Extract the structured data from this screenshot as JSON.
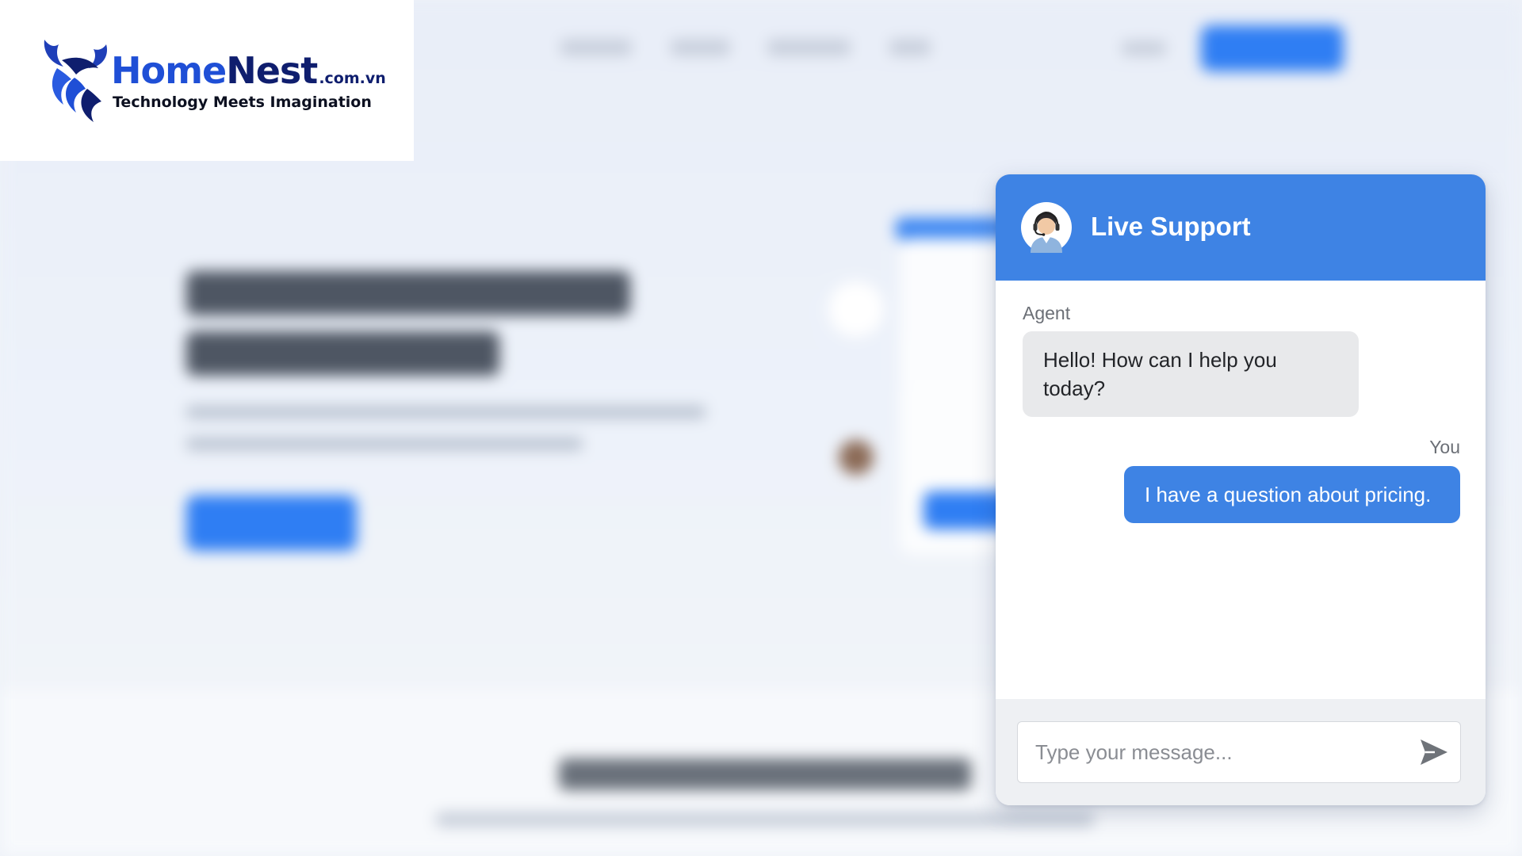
{
  "brand": {
    "name_part1": "Home",
    "name_part2": "Nest",
    "domain": ".com.vn",
    "tagline": "Technology Meets Imagination"
  },
  "chat": {
    "title": "Live Support",
    "messages": [
      {
        "sender": "Agent",
        "text": "Hello! How can I help you today?"
      },
      {
        "sender": "You",
        "text": "I have a question about pricing."
      }
    ],
    "input": {
      "placeholder": "Type your message...",
      "value": ""
    }
  },
  "icons": {
    "logo": "bull-horn-logo-icon",
    "agent_avatar": "support-agent-headset-icon",
    "send": "send-arrow-icon"
  },
  "colors": {
    "chat_accent": "#3e83e4",
    "brand_blue": "#1f4fd6",
    "brand_navy": "#0f1e6e"
  }
}
